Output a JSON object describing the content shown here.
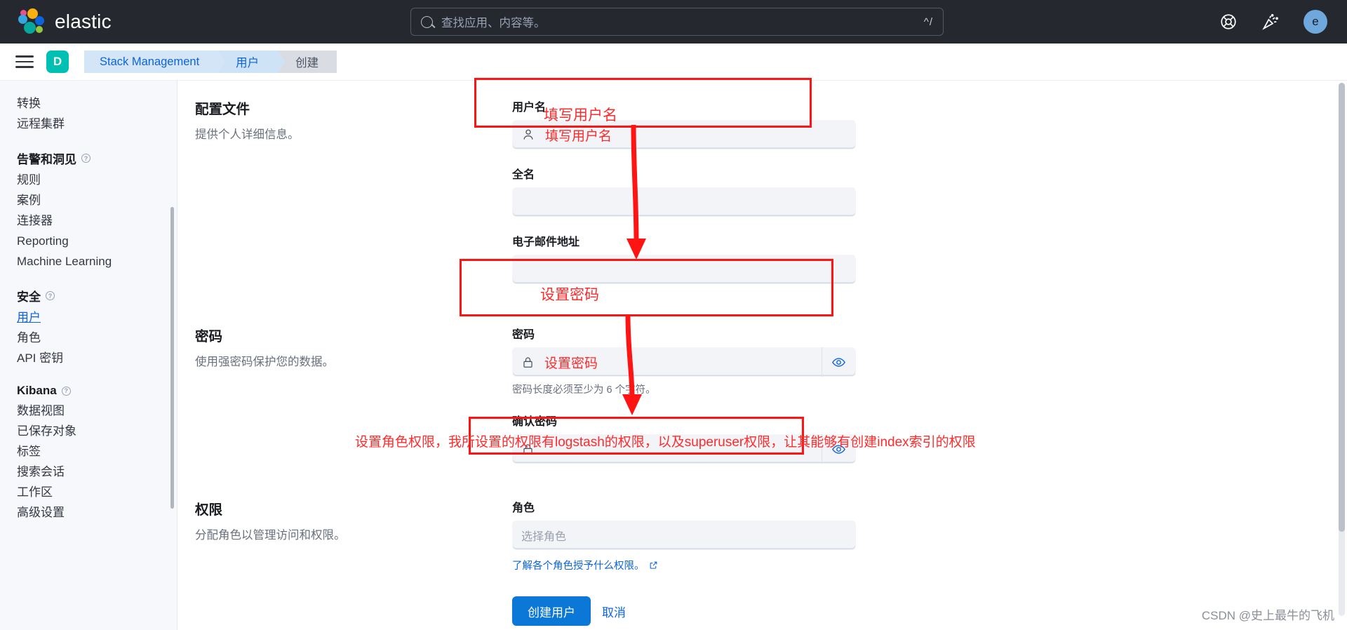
{
  "header": {
    "brand": "elastic",
    "search": {
      "placeholder": "查找应用、内容等。",
      "shortcut": "^/",
      "icon": "search-icon"
    },
    "icons": [
      {
        "name": "help-icon",
        "label": "帮助"
      },
      {
        "name": "announcements-icon",
        "label": "新公告"
      }
    ],
    "avatar": "e"
  },
  "breadcrumb": {
    "space_badge": "D",
    "items": [
      {
        "label": "Stack Management",
        "state": "link"
      },
      {
        "label": "用户",
        "state": "link"
      },
      {
        "label": "创建",
        "state": "current"
      }
    ]
  },
  "sidebar": {
    "items_top": [
      {
        "label": "转换"
      },
      {
        "label": "远程集群"
      }
    ],
    "group_alerts": {
      "label": "告警和洞见",
      "items": [
        {
          "label": "规则"
        },
        {
          "label": "案例"
        },
        {
          "label": "连接器"
        },
        {
          "label": "Reporting"
        },
        {
          "label": "Machine Learning"
        }
      ]
    },
    "group_security": {
      "label": "安全",
      "items": [
        {
          "label": "用户",
          "active": true
        },
        {
          "label": "角色"
        },
        {
          "label": "API 密钥"
        }
      ]
    },
    "group_kibana": {
      "label": "Kibana",
      "items": [
        {
          "label": "数据视图"
        },
        {
          "label": "已保存对象"
        },
        {
          "label": "标签"
        },
        {
          "label": "搜索会话"
        },
        {
          "label": "工作区"
        },
        {
          "label": "高级设置"
        }
      ]
    }
  },
  "form": {
    "profile": {
      "title": "配置文件",
      "desc": "提供个人详细信息。",
      "username": {
        "label": "用户名",
        "value": "填写用户名",
        "icon": "user-icon"
      },
      "fullname": {
        "label": "全名",
        "value": ""
      },
      "email": {
        "label": "电子邮件地址",
        "value": ""
      }
    },
    "password": {
      "title": "密码",
      "desc": "使用强密码保护您的数据。",
      "password": {
        "label": "密码",
        "value": "设置密码",
        "icon": "lock-icon",
        "help": "密码长度必须至少为 6 个字符。"
      },
      "confirm": {
        "label": "确认密码",
        "value": "",
        "icon": "lock-icon"
      }
    },
    "permissions": {
      "title": "权限",
      "desc": "分配角色以管理访问和权限。",
      "roles": {
        "label": "角色",
        "placeholder": "选择角色",
        "link": "了解各个角色授予什么权限。"
      }
    },
    "actions": {
      "submit": "创建用户",
      "cancel": "取消"
    }
  },
  "annotations": {
    "username_note": "填写用户名",
    "password_note": "设置密码",
    "roles_note": "设置角色权限，我所设置的权限有logstash的权限，以及superuser权限，让其能够有创建index索引的权限",
    "color": "#ff1414"
  },
  "watermark": "CSDN @史上最牛的飞机"
}
